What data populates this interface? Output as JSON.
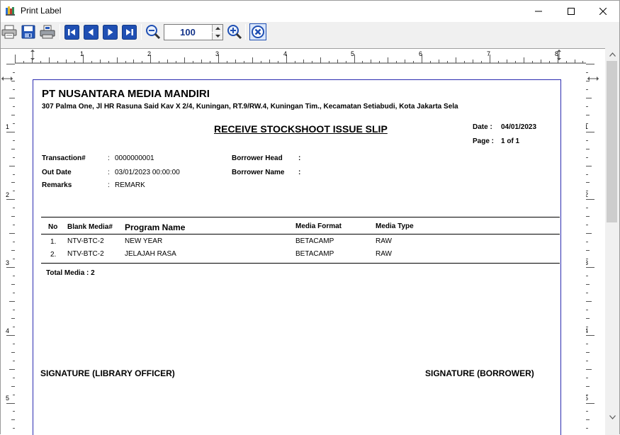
{
  "window": {
    "title": "Print Label",
    "controls": {
      "minimize": "minimize",
      "maximize": "maximize",
      "close": "close"
    }
  },
  "toolbar": {
    "buttons": [
      {
        "name": "print-button",
        "icon": "printer-icon"
      },
      {
        "name": "save-button",
        "icon": "floppy-disk-icon"
      },
      {
        "name": "printer-setup-button",
        "icon": "printer-setup-icon"
      },
      {
        "name": "first-page-button",
        "icon": "first-page-icon"
      },
      {
        "name": "previous-page-button",
        "icon": "previous-page-icon"
      },
      {
        "name": "next-page-button",
        "icon": "next-page-icon"
      },
      {
        "name": "last-page-button",
        "icon": "last-page-icon"
      },
      {
        "name": "zoom-out-button",
        "icon": "zoom-out-icon"
      },
      {
        "name": "zoom-in-button",
        "icon": "zoom-in-icon"
      },
      {
        "name": "close-preview-button",
        "icon": "close-circle-icon"
      }
    ],
    "zoom_value": "100"
  },
  "rulers": {
    "horizontal_labels": [
      "1",
      "2",
      "3",
      "4",
      "5",
      "6",
      "7",
      "8"
    ],
    "vertical_labels": [
      "1",
      "2",
      "3",
      "4",
      "5"
    ]
  },
  "report": {
    "company_name": "PT NUSANTARA MEDIA MANDIRI",
    "company_address": "307 Palma One, Jl HR Rasuna Said Kav X 2/4, Kuningan, RT.9/RW.4, Kuningan Tim., Kecamatan Setiabudi, Kota Jakarta Sela",
    "title": "RECEIVE STOCKSHOOT ISSUE SLIP",
    "date_label": "Date :",
    "date_value": "04/01/2023",
    "page_label": "Page :",
    "page_value": "1 of 1",
    "fields": {
      "transaction_label": "Transaction#",
      "transaction_value": "0000000001",
      "out_date_label": "Out Date",
      "out_date_value": "03/01/2023 00:00:00",
      "remarks_label": "Remarks",
      "remarks_value": "REMARK",
      "borrower_head_label": "Borrower Head",
      "borrower_head_value": "",
      "borrower_name_label": "Borrower Name",
      "borrower_name_value": "",
      "colon": ":"
    },
    "table": {
      "headers": [
        "No",
        "Blank Media#",
        "Program Name",
        "Media Format",
        "Media Type"
      ],
      "rows": [
        [
          "1.",
          "NTV-BTC-2",
          "NEW YEAR",
          "BETACAMP",
          "RAW"
        ],
        [
          "2.",
          "NTV-BTC-2",
          "JELAJAH RASA",
          "BETACAMP",
          "RAW"
        ]
      ]
    },
    "total_label": "Total Media : 2",
    "signature_left": "SIGNATURE (LIBRARY OFFICER)",
    "signature_right": "SIGNATURE (BORROWER)"
  },
  "colors": {
    "margin_line": "#2b2bb0",
    "toolbar_icon_blue": "#1f4fb3",
    "zoom_text": "#14348a"
  }
}
